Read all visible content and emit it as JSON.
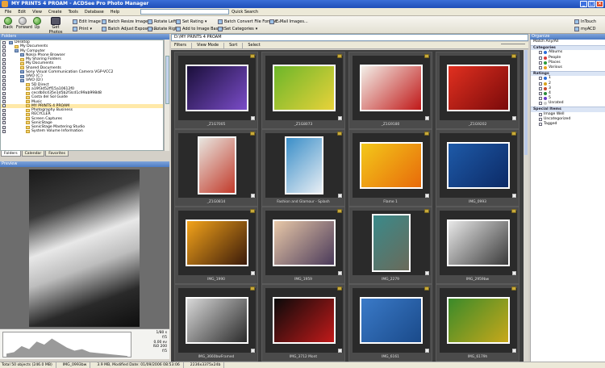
{
  "window": {
    "title": "MY PRINTS 4 PROAM - ACDSee Pro Photo Manager"
  },
  "menu": [
    "File",
    "Edit",
    "View",
    "Create",
    "Tools",
    "Database",
    "Help"
  ],
  "quick_search": {
    "label": "Quick Search"
  },
  "toolbar": {
    "back": "Back",
    "forward": "Forward",
    "up": "Up",
    "get_photos": "Get Photos",
    "edit_image": "Edit Image",
    "print": "Print",
    "batch_resize": "Batch Resize Images...",
    "batch_adjust": "Batch Adjust Exposure...",
    "rotate_left": "Rotate Left",
    "rotate_right": "Rotate Right",
    "set_rating": "Set Rating",
    "add_basket": "Add to Image Basket",
    "batch_convert": "Batch Convert File Format...",
    "set_categories": "Set Categories",
    "email": "E-Mail Images...",
    "intouch": "InTouch",
    "myacd": "myACD"
  },
  "folders_panel": {
    "title": "Folders",
    "tree": [
      {
        "label": "Desktop",
        "indent": 0,
        "sys": true
      },
      {
        "label": "My Documents",
        "indent": 1,
        "sys": false
      },
      {
        "label": "My Computer",
        "indent": 1,
        "sys": true
      },
      {
        "label": "Nokia Phone Browser",
        "indent": 2,
        "sys": true
      },
      {
        "label": "My Sharing Folders",
        "indent": 2,
        "sys": false
      },
      {
        "label": "My Documents",
        "indent": 2,
        "sys": false
      },
      {
        "label": "Shared Documents",
        "indent": 2,
        "sys": false
      },
      {
        "label": "Sony Visual Communication Camera VGP-VCC2",
        "indent": 2,
        "sys": true
      },
      {
        "label": "VAIO (C:)",
        "indent": 2,
        "sys": true
      },
      {
        "label": "VAIO (D:)",
        "indent": 2,
        "sys": true
      },
      {
        "label": "5D Direct",
        "indent": 3,
        "sys": false
      },
      {
        "label": "a19f3d52ff15a10612f0",
        "indent": 3,
        "sys": false
      },
      {
        "label": "cecdb0c435e1d5b2f3cd1c99ab998d8",
        "indent": 3,
        "sys": false
      },
      {
        "label": "Costa del Sol Guide",
        "indent": 3,
        "sys": false
      },
      {
        "label": "Music",
        "indent": 3,
        "sys": false
      },
      {
        "label": "MY PRINTS 4 PROAM",
        "indent": 3,
        "sys": false,
        "selected": true
      },
      {
        "label": "Photography Business",
        "indent": 3,
        "sys": false
      },
      {
        "label": "RECYCLER",
        "indent": 3,
        "sys": false
      },
      {
        "label": "Screen Captures",
        "indent": 3,
        "sys": false
      },
      {
        "label": "SonicStage",
        "indent": 3,
        "sys": false
      },
      {
        "label": "SonicStage Mastering Studio",
        "indent": 3,
        "sys": false
      },
      {
        "label": "System Volume Information",
        "indent": 3,
        "sys": false
      }
    ],
    "tabs": [
      "Folders",
      "Calendar",
      "Favorites"
    ]
  },
  "preview": {
    "title": "Preview",
    "info": [
      "1/80 s",
      "f/5",
      "0.00 ev",
      "ISO 200",
      "f/5"
    ]
  },
  "browser": {
    "path": "D:\\MY PRINTS 4 PROAM",
    "toolbar": [
      "Filters",
      "View Mode",
      "Sort",
      "Select"
    ],
    "thumbs": [
      {
        "cap": "_Z1G7005",
        "c": [
          "#1a0f3a",
          "#7a4cc8"
        ]
      },
      {
        "cap": "_Z1G8073",
        "c": [
          "#6cb62a",
          "#e8d23a"
        ]
      },
      {
        "cap": "_Z1G9180",
        "c": [
          "#f3efe8",
          "#c01818"
        ]
      },
      {
        "cap": "_Z1G9202",
        "c": [
          "#e13020",
          "#7a0a0a"
        ]
      },
      {
        "cap": "_Z1G0814",
        "c": [
          "#e8e6e0",
          "#c23a2a"
        ]
      },
      {
        "cap": "Fashion and Glamour - Splash",
        "c": [
          "#3a8ec8",
          "#e8eef4"
        ]
      },
      {
        "cap": "Flame 1",
        "c": [
          "#f3c81a",
          "#e86a0a"
        ]
      },
      {
        "cap": "IMG_0993",
        "c": [
          "#1e5aa8",
          "#0c2a66"
        ]
      },
      {
        "cap": "IMG_1990",
        "c": [
          "#f3a31a",
          "#3a1a0a"
        ]
      },
      {
        "cap": "IMG_1959",
        "c": [
          "#e8c8a8",
          "#4a3a5a"
        ]
      },
      {
        "cap": "IMG_2279",
        "c": [
          "#3a8a8a",
          "#6a6a5a"
        ]
      },
      {
        "cap": "IMG_2959bw",
        "c": [
          "#e8e8e8",
          "#3a3a3a"
        ]
      },
      {
        "cap": "IMG_3660bwFramed",
        "c": [
          "#d8d8d8",
          "#2a2a2a"
        ]
      },
      {
        "cap": "IMG_3712 Mont",
        "c": [
          "#0a0a0a",
          "#c21a1a"
        ]
      },
      {
        "cap": "IMG_6161",
        "c": [
          "#3a7ac8",
          "#1a4a8a"
        ]
      },
      {
        "cap": "IMG_6179h",
        "c": [
          "#3a8a2a",
          "#c8a81a"
        ]
      }
    ]
  },
  "organize": {
    "title": "Organize",
    "match": "Match Any/All",
    "categories_label": "Categories",
    "categories": [
      "Albums",
      "People",
      "Places",
      "Various"
    ],
    "ratings_label": "Ratings",
    "ratings": [
      "1",
      "2",
      "3",
      "4",
      "5",
      "Unrated"
    ],
    "special_label": "Special Items",
    "special": [
      "Image Well",
      "Uncategorized",
      "Tagged"
    ],
    "colors": {
      "albums": "#2a6bd8",
      "people": "#d83a3a",
      "places": "#2a9a3a",
      "various": "#e8a21a",
      "r1": "#2a6bd8",
      "r2": "#d8a21a",
      "r3": "#c84a2a",
      "r4": "#2a8a3a",
      "r5": "#6a3ac8"
    }
  },
  "status": {
    "total": "Total 50 objects (246.0 MB)",
    "file": "IMG_0993bw",
    "details": "3.9 MB, Modified Date: 01/09/2006 08:53:06",
    "dims": "2236x3375x24b"
  }
}
